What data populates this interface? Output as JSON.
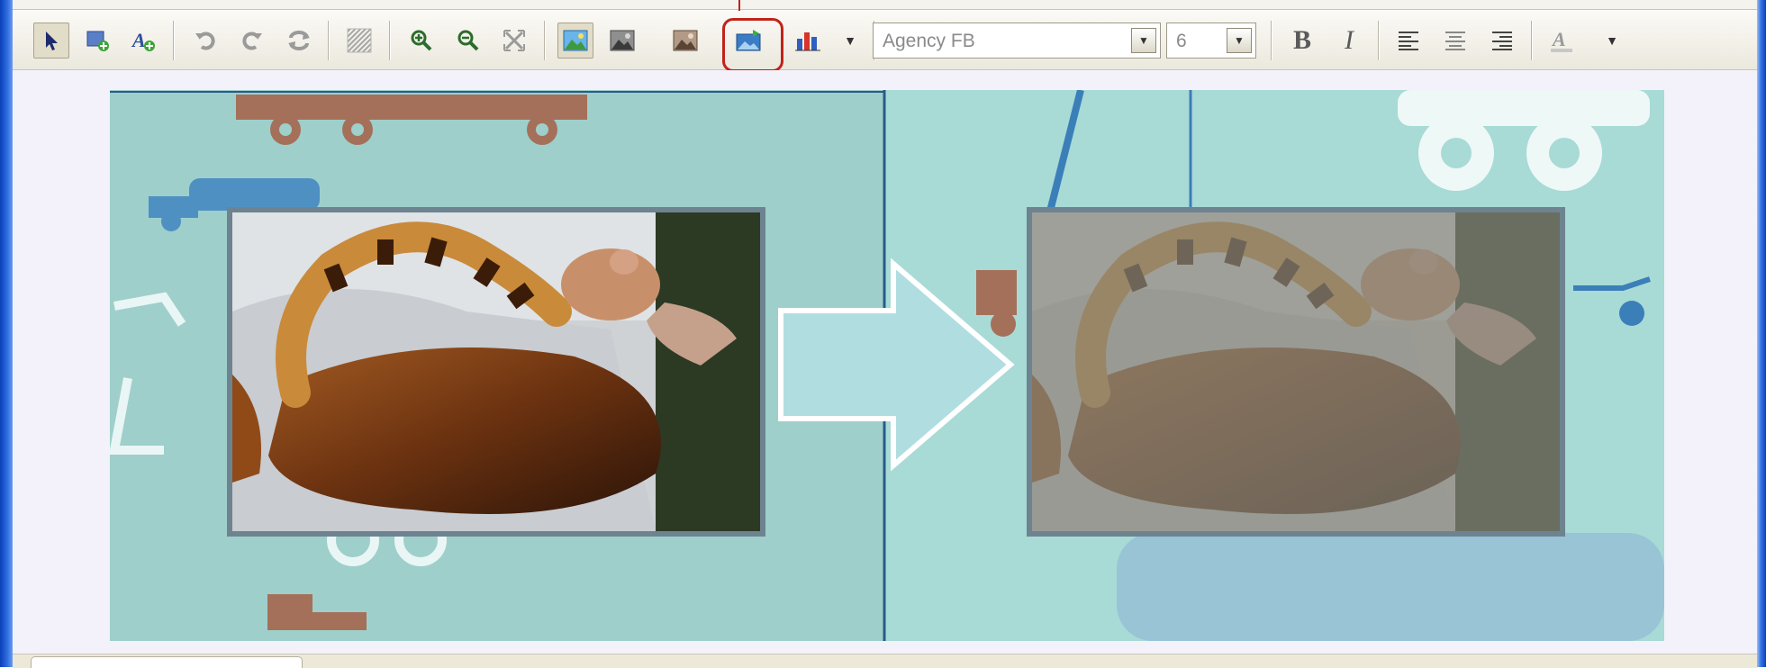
{
  "toolbar": {
    "font_family": "Agency FB",
    "font_size": "6",
    "bold_label": "B",
    "italic_label": "I",
    "buttons": [
      {
        "name": "select-pointer-icon",
        "active": true
      },
      {
        "name": "insert-box-icon"
      },
      {
        "name": "insert-text-icon"
      },
      {
        "name": "rotate-left-icon"
      },
      {
        "name": "rotate-right-icon"
      },
      {
        "name": "flip-icon"
      },
      {
        "name": "pattern-icon"
      },
      {
        "name": "zoom-in-icon"
      },
      {
        "name": "zoom-out-icon"
      },
      {
        "name": "fit-icon"
      },
      {
        "name": "image-normal-icon",
        "active": true
      },
      {
        "name": "image-dark-icon"
      },
      {
        "name": "image-sepia-icon"
      },
      {
        "name": "image-fade-icon",
        "highlighted": true
      },
      {
        "name": "chart-icon"
      }
    ]
  },
  "colors": {
    "highlight": "#c0231a",
    "slide_background": "#a4d7d2",
    "arrow_fill": "#b0dde0",
    "photo_border": "#6e8390"
  }
}
